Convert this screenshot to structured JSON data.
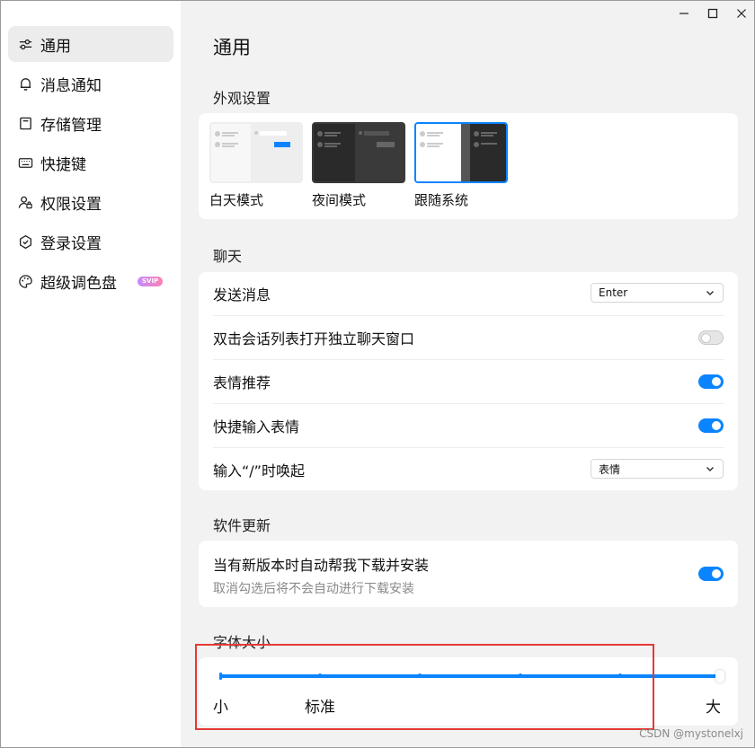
{
  "window": {
    "minimize_icon": "minimize-icon",
    "maximize_icon": "maximize-icon",
    "close_icon": "close-icon"
  },
  "sidebar": {
    "items": [
      {
        "label": "通用",
        "icon": "sliders-icon",
        "active": true
      },
      {
        "label": "消息通知",
        "icon": "bell-icon"
      },
      {
        "label": "存储管理",
        "icon": "folder-icon"
      },
      {
        "label": "快捷键",
        "icon": "keyboard-icon"
      },
      {
        "label": "权限设置",
        "icon": "user-lock-icon"
      },
      {
        "label": "登录设置",
        "icon": "hexagon-icon"
      },
      {
        "label": "超级调色盘",
        "icon": "palette-icon",
        "badge": "SVIP"
      }
    ]
  },
  "main": {
    "title": "通用",
    "appearance": {
      "title": "外观设置",
      "themes": [
        {
          "label": "白天模式"
        },
        {
          "label": "夜间模式"
        },
        {
          "label": "跟随系统",
          "selected": true
        }
      ]
    },
    "chat": {
      "title": "聊天",
      "send_message": {
        "label": "发送消息",
        "value": "Enter"
      },
      "double_click": {
        "label": "双击会话列表打开独立聊天窗口",
        "enabled": false
      },
      "emoji_recommend": {
        "label": "表情推荐",
        "enabled": true
      },
      "quick_emoji": {
        "label": "快捷输入表情",
        "enabled": true
      },
      "slash_invoke": {
        "label": "输入“/”时唤起",
        "value": "表情"
      }
    },
    "update": {
      "title": "软件更新",
      "auto_update": {
        "label": "当有新版本时自动帮我下载并安装",
        "sub": "取消勾选后将不会自动进行下载安装",
        "enabled": true
      }
    },
    "font_size": {
      "title": "字体大小",
      "min_label": "小",
      "standard_label": "标准",
      "max_label": "大",
      "steps": 6,
      "value_step": 5
    }
  },
  "watermark": "CSDN @mystonelxj",
  "colors": {
    "accent": "#0a84ff",
    "highlight_box": "#e53935"
  }
}
